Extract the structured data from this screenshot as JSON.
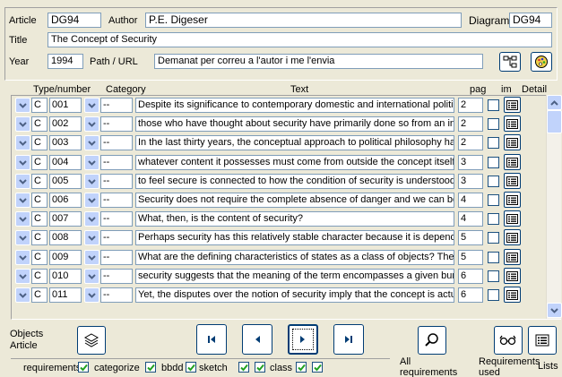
{
  "header": {
    "article_label": "Article",
    "article_value": "DG94",
    "author_label": "Author",
    "author_value": "P.E. Digeser",
    "diagram_label": "Diagram:",
    "diagram_value": "DG94",
    "title_label": "Title",
    "title_value": "The Concept of Security",
    "year_label": "Year",
    "year_value": "1994",
    "path_label": "Path / URL",
    "path_value": "Demanat per correu a l'autor i me l'envia"
  },
  "columns": {
    "type_number": "Type/number",
    "category": "Category",
    "text": "Text",
    "pag": "pag",
    "im": "im",
    "detail": "Detail"
  },
  "rows": [
    {
      "type": "C",
      "number": "001",
      "category": "--",
      "text": "Despite its significance to contemporary domestic and international politics,",
      "pag": "2",
      "im": false
    },
    {
      "type": "C",
      "number": "002",
      "category": "--",
      "text": " those who have thought about security have primarily done so from an inte",
      "pag": "2",
      "im": false
    },
    {
      "type": "C",
      "number": "003",
      "category": "--",
      "text": "In the last thirty years, the conceptual approach to political philosophy has",
      "pag": "2",
      "im": false
    },
    {
      "type": "C",
      "number": "004",
      "category": "--",
      "text": "whatever content it possesses must come from outside the concept itself.",
      "pag": "3",
      "im": false
    },
    {
      "type": "C",
      "number": "005",
      "category": "--",
      "text": "to feel secure is connected to how the condition of security is understood.",
      "pag": "3",
      "im": false
    },
    {
      "type": "C",
      "number": "006",
      "category": "--",
      "text": "Security does not require the complete absence of danger and we can be",
      "pag": "4",
      "im": false
    },
    {
      "type": "C",
      "number": "007",
      "category": "--",
      "text": "What, then, is the content of security?",
      "pag": "4",
      "im": false
    },
    {
      "type": "C",
      "number": "008",
      "category": "--",
      "text": "Perhaps security has this relatively stable character because it is depender",
      "pag": "5",
      "im": false
    },
    {
      "type": "C",
      "number": "009",
      "category": "--",
      "text": "What are the defining characteristics of states as a class of objects?  They",
      "pag": "5",
      "im": false
    },
    {
      "type": "C",
      "number": "010",
      "category": "--",
      "text": "security suggests that the meaning of the term encompasses a given bundl",
      "pag": "6",
      "im": false
    },
    {
      "type": "C",
      "number": "011",
      "category": "--",
      "text": "Yet, the disputes over the notion of security imply that the concept is actua",
      "pag": "6",
      "im": false
    }
  ],
  "footer": {
    "objects_article_line1": "Objects",
    "objects_article_line2": "Article",
    "all_requirements_line1": "All",
    "all_requirements_line2": "requirements",
    "requirements_used_line1": "Requirements",
    "requirements_used_line2": "used",
    "lists_label": "Lists",
    "check_requirements": "requirements",
    "check_categorize": "categorize",
    "check_bbdd": "bbdd",
    "check_sketch": "sketch",
    "check_class": "class"
  },
  "icons": {
    "diagram_button": "diagram-icon",
    "palette_button": "palette-icon",
    "objects_article_button": "stack-icon",
    "nav_first": "first-icon",
    "nav_prev": "prev-icon",
    "nav_next": "next-icon",
    "nav_last": "last-icon",
    "search": "magnifier-icon",
    "glasses": "glasses-icon",
    "lists": "list-icon"
  },
  "colors": {
    "background": "#ece9d8",
    "field_border": "#7f9db9",
    "button_border": "#003c74",
    "dropdown": "#c1d3fb",
    "check": "#21a121"
  }
}
